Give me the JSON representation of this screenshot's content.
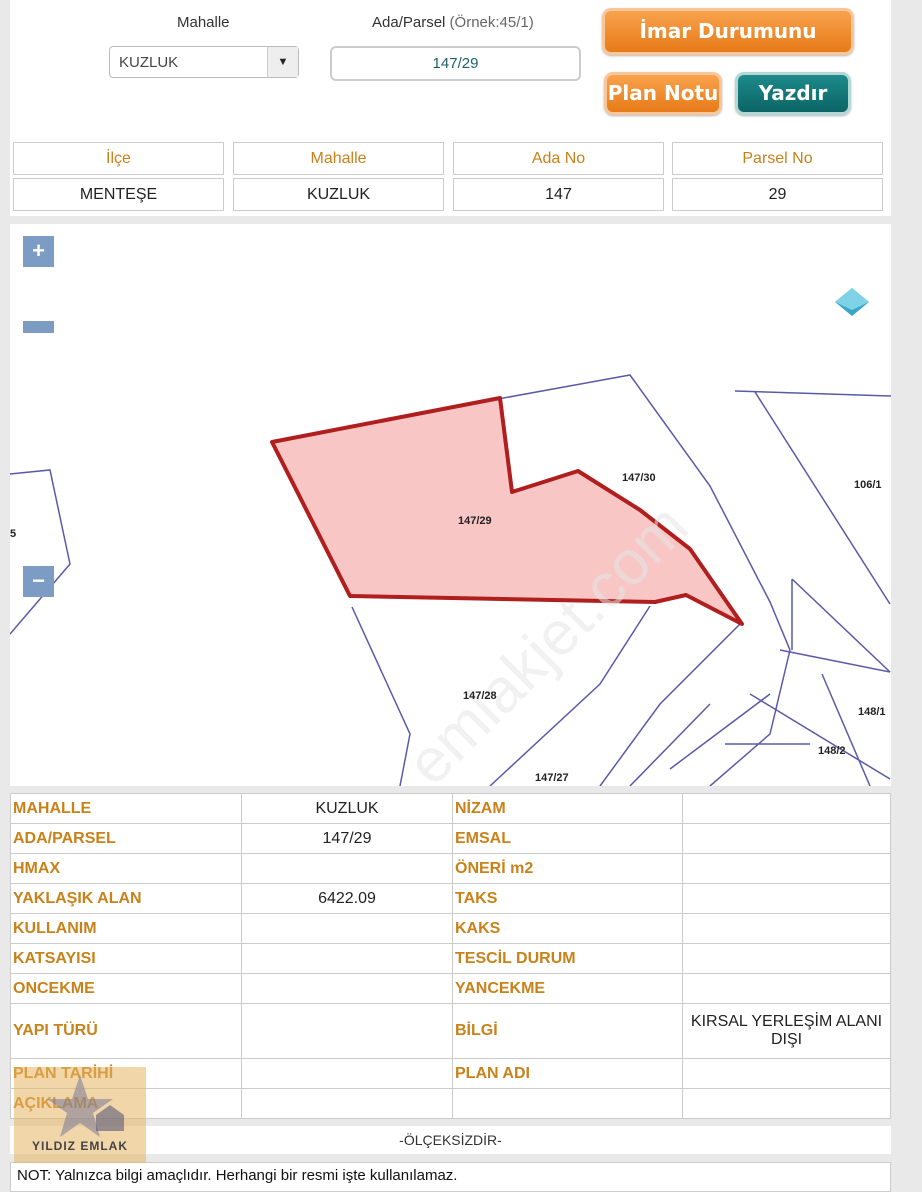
{
  "query": {
    "mahalle_label": "Mahalle",
    "ada_parsel_label": "Ada/Parsel",
    "ada_parsel_hint": "(Örnek:45/1)",
    "mahalle_value": "KUZLUK",
    "ada_parsel_value": "147/29",
    "btn_sorgula": "İmar Durumunu Sorgula",
    "btn_plan_notu": "Plan Notu",
    "btn_yazdir": "Yazdır"
  },
  "summary": {
    "headers": [
      "İlçe",
      "Mahalle",
      "Ada No",
      "Parsel No"
    ],
    "values": [
      "MENTEŞE",
      "KUZLUK",
      "147",
      "29"
    ]
  },
  "map": {
    "zoom_in": "+",
    "zoom_out": "−",
    "side_btn": "−",
    "watermark": "emlakjet.com",
    "parcel_labels": [
      "147/29",
      "147/30",
      "106/1",
      "147/28",
      "147/27",
      "148/1",
      "148/2",
      "5"
    ],
    "highlight_color": "#b01e1e",
    "highlight_fill": "#f9c6c6",
    "line_color": "#5a5aa8"
  },
  "info": {
    "rows": [
      [
        "MAHALLE",
        "KUZLUK",
        "NİZAM",
        ""
      ],
      [
        "ADA/PARSEL",
        "147/29",
        "EMSAL",
        ""
      ],
      [
        "HMAX",
        "",
        "ÖNERİ m2",
        ""
      ],
      [
        "YAKLAŞIK ALAN",
        "6422.09",
        "TAKS",
        ""
      ],
      [
        "KULLANIM",
        "",
        "KAKS",
        ""
      ],
      [
        "KATSAYISI",
        "",
        "TESCİL DURUM",
        ""
      ],
      [
        "ONCEKME",
        "",
        "YANCEKME",
        ""
      ],
      [
        "YAPI TÜRÜ",
        "",
        "BİLGİ",
        "KIRSAL YERLEŞİM ALANI DIŞI"
      ],
      [
        "PLAN TARİHİ",
        "",
        "PLAN ADI",
        ""
      ],
      [
        "AÇIKLAMA",
        "",
        "",
        ""
      ]
    ]
  },
  "scale_text": "-ÖLÇEKSİZDİR-",
  "note_text": "NOT: Yalnızca bilgi amaçlıdır. Herhangi bir resmi işte kullanılamaz.",
  "logo_text": "YILDIZ EMLAK"
}
